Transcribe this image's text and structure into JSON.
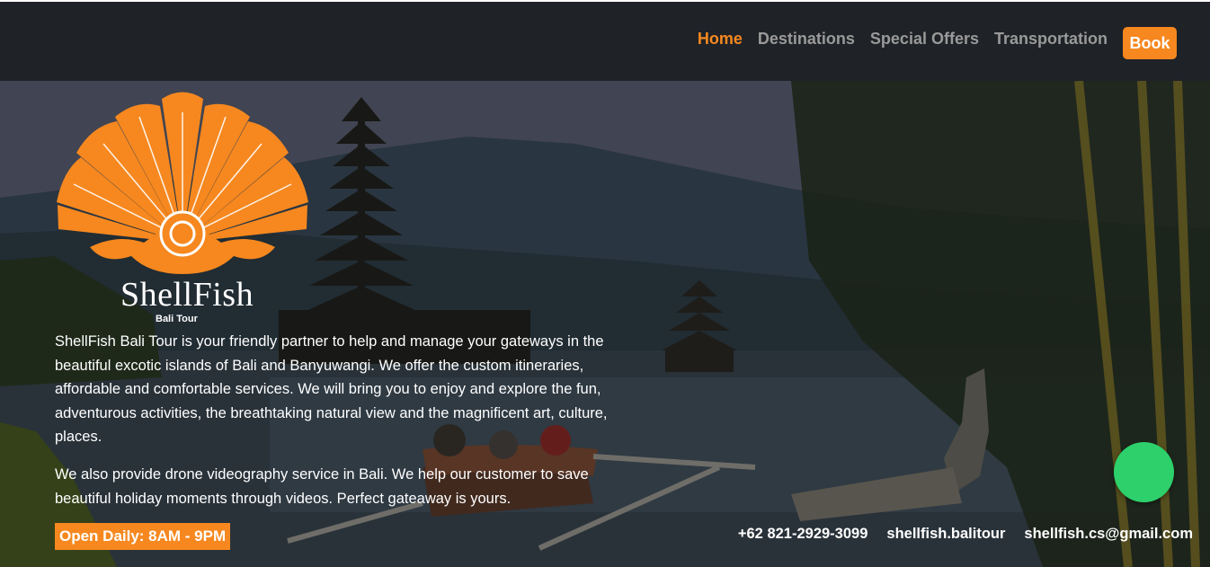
{
  "nav": {
    "links": [
      {
        "label": "Home",
        "active": true
      },
      {
        "label": "Destinations",
        "active": false
      },
      {
        "label": "Special Offers",
        "active": false
      },
      {
        "label": "Transportation",
        "active": false
      }
    ],
    "book_label": "Book"
  },
  "brand": {
    "name": "ShellFish",
    "subtitle": "Bali Tour"
  },
  "hero": {
    "intro": "ShellFish Bali Tour is your friendly partner to help and manage your gateways in the beautiful excotic islands of Bali and Banyuwangi. We offer the custom itineraries, affordable and comfortable services. We will bring you to enjoy and explore the fun, adventurous activities, the breathtaking natural view and the magnificent art, culture, places.",
    "drone": "We also provide drone videography service in Bali. We help our customer to save beautiful holiday moments through videos. Perfect gateaway is yours.",
    "hours": "Open Daily: 8AM - 9PM"
  },
  "contacts": {
    "phone": "+62 821-2929-3099",
    "instagram": "shellfish.balitour",
    "email": "shellfish.cs@gmail.com"
  },
  "colors": {
    "accent": "#f6881f",
    "navbar": "#1f2227",
    "chat": "#2ed06b"
  }
}
